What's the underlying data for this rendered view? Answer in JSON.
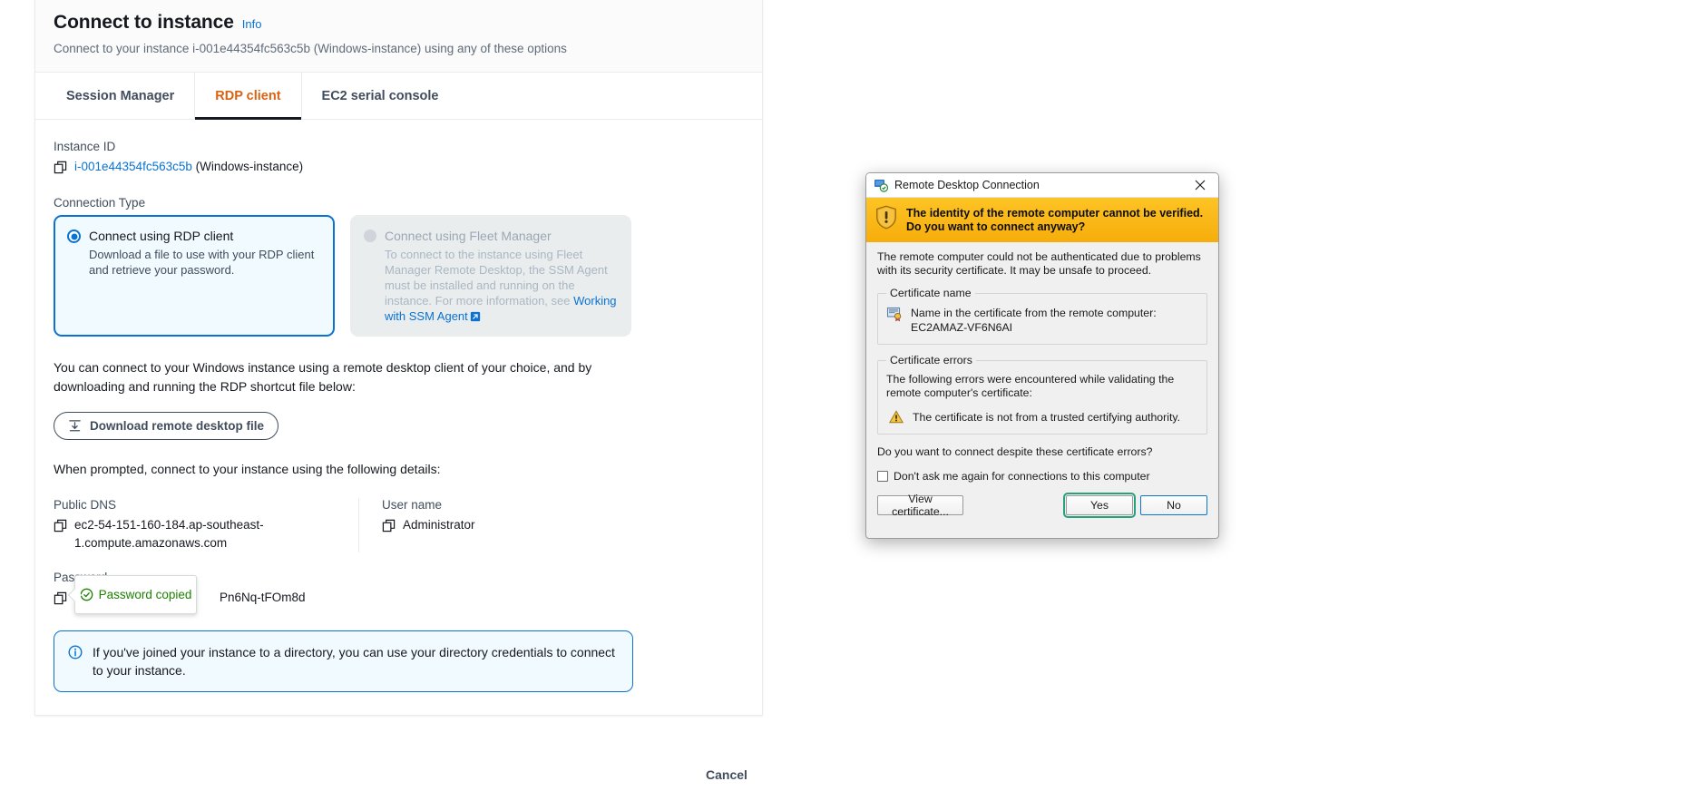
{
  "panel": {
    "title": "Connect to instance",
    "info_link": "Info",
    "subtitle": "Connect to your instance i-001e44354fc563c5b (Windows-instance) using any of these options",
    "tabs": [
      {
        "label": "Session Manager",
        "active": false
      },
      {
        "label": "RDP client",
        "active": true
      },
      {
        "label": "EC2 serial console",
        "active": false
      }
    ],
    "instance_id_label": "Instance ID",
    "instance_id_value": "i-001e44354fc563c5b",
    "instance_id_suffix": "(Windows-instance)",
    "connection_type_label": "Connection Type",
    "options": [
      {
        "title": "Connect using RDP client",
        "description": "Download a file to use with your RDP client and retrieve your password.",
        "selected": true,
        "disabled": false
      },
      {
        "title": "Connect using Fleet Manager",
        "description": "To connect to the instance using Fleet Manager Remote Desktop, the SSM Agent must be installed and running on the instance. For more information, see ",
        "link_text": "Working with SSM Agent",
        "selected": false,
        "disabled": true
      }
    ],
    "intro_paragraph": "You can connect to your Windows instance using a remote desktop client of your choice, and by downloading and running the RDP shortcut file below:",
    "download_button": "Download remote desktop file",
    "prompt_paragraph": "When prompted, connect to your instance using the following details:",
    "public_dns_label": "Public DNS",
    "public_dns_value": "ec2-54-151-160-184.ap-southeast-1.compute.amazonaws.com",
    "user_name_label": "User name",
    "user_name_value": "Administrator",
    "password_label": "Password",
    "password_value": "Pn6Nq-tFOm8d",
    "password_tooltip": "Password copied",
    "alert_text": "If you've joined your instance to a directory, you can use your directory credentials to connect to your instance.",
    "cancel_button": "Cancel"
  },
  "rdp_dialog": {
    "title": "Remote Desktop Connection",
    "banner_text": "The identity of the remote computer cannot be verified. Do you want to connect anyway?",
    "body_text": "The remote computer could not be authenticated due to problems with its security certificate. It may be unsafe to proceed.",
    "cert_name_legend": "Certificate name",
    "cert_name_text": "Name in the certificate from the remote computer:",
    "cert_name_value": "EC2AMAZ-VF6N6AI",
    "cert_errors_legend": "Certificate errors",
    "cert_errors_text": "The following errors were encountered while validating the remote computer's certificate:",
    "cert_error_item": "The certificate is not from a trusted certifying authority.",
    "question": "Do you want to connect despite these certificate errors?",
    "checkbox_label": "Don't ask me again for connections to this computer",
    "view_certificate_button": "View certificate...",
    "yes_button": "Yes",
    "no_button": "No"
  },
  "colors": {
    "accent_orange": "#d96213",
    "link_blue": "#0972d3",
    "warning_yellow": "#fcb911",
    "success_green": "#1d8102"
  }
}
